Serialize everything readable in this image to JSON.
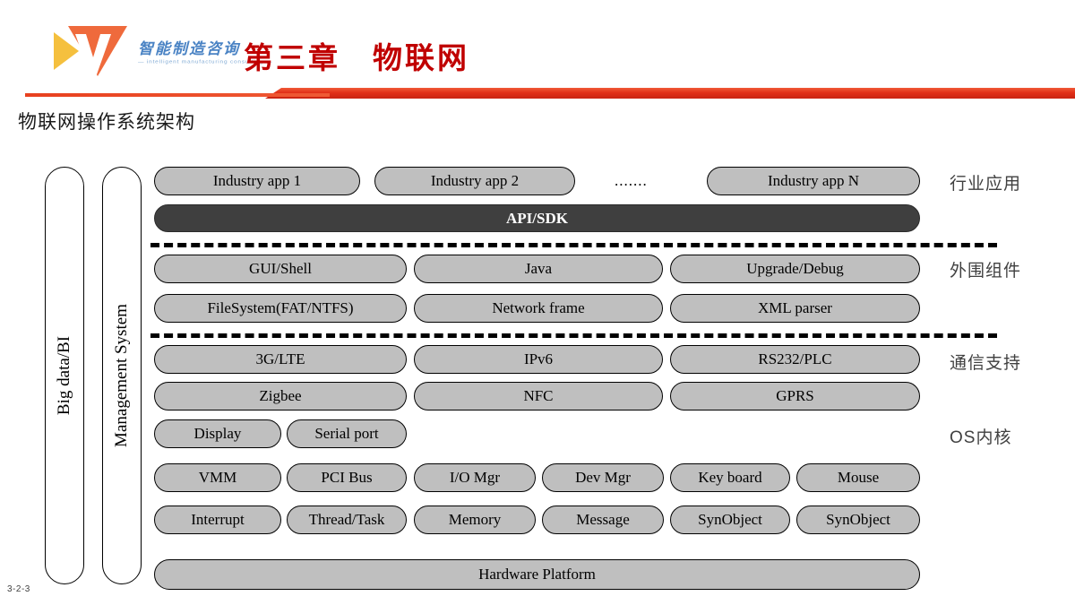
{
  "header": {
    "logo_cn": "智能制造咨询",
    "logo_en": "— intelligent manufacturing consulting —",
    "title": "第三章　物联网"
  },
  "section": {
    "title": "物联网操作系统架构"
  },
  "page_number": "3-2-3",
  "vertical_bars": [
    {
      "label": "Big data/BI"
    },
    {
      "label": "Management System"
    }
  ],
  "layers": {
    "industry_apps": {
      "side_label": "行业应用",
      "items": [
        "Industry app 1",
        "Industry app 2",
        "Industry app N"
      ],
      "ellipsis": "......."
    },
    "api_sdk": {
      "label": "API/SDK"
    },
    "peripheral": {
      "side_label": "外围组件",
      "row1": [
        "GUI/Shell",
        "Java",
        "Upgrade/Debug"
      ],
      "row2": [
        "FileSystem(FAT/NTFS)",
        "Network frame",
        "XML parser"
      ]
    },
    "communication": {
      "side_label": "通信支持",
      "row1": [
        "3G/LTE",
        "IPv6",
        "RS232/PLC"
      ],
      "row2": [
        "Zigbee",
        "NFC",
        "GPRS"
      ]
    },
    "os_kernel": {
      "side_label": "OS内核",
      "row_drivers": [
        "Display",
        "Serial port"
      ],
      "row1": [
        "VMM",
        "PCI Bus",
        "I/O Mgr",
        "Dev Mgr",
        "Key board",
        "Mouse"
      ],
      "row2": [
        "Interrupt",
        "Thread/Task",
        "Memory",
        "Message",
        "SynObject",
        "SynObject"
      ]
    },
    "hardware": {
      "label": "Hardware Platform"
    }
  },
  "colors": {
    "accent_red": "#c00000",
    "divider_red": "#e13018",
    "pill_fill": "#bfbfbf",
    "pill_dark": "#3f3f3f",
    "logo_blue": "#4a83c4"
  }
}
